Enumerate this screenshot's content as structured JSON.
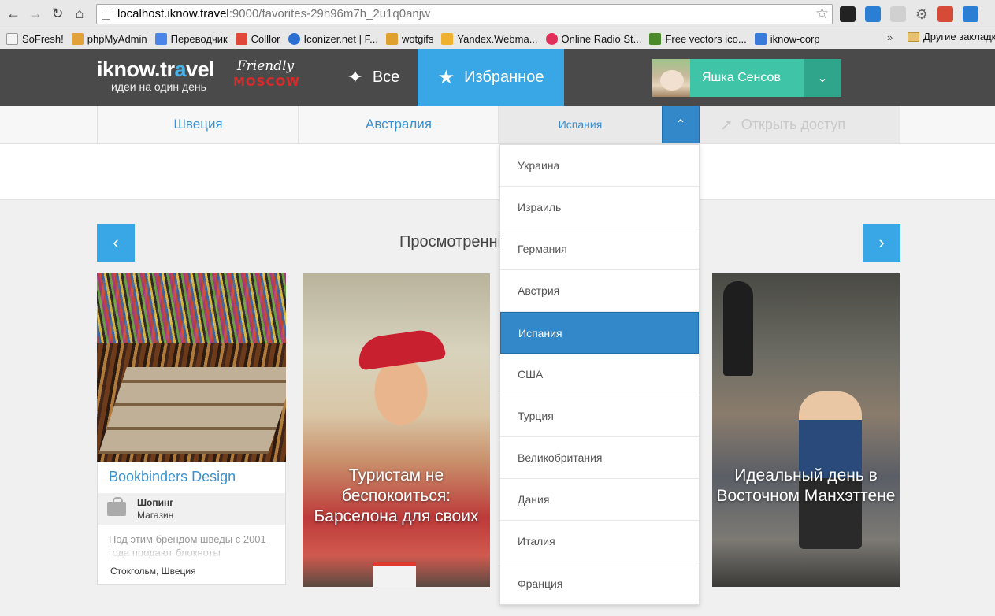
{
  "browser": {
    "url_host": "localhost.iknow.travel",
    "url_rest": ":9000/favorites-29h96m7h_2u1q0anjw",
    "bookmarks": [
      {
        "label": "SoFresh!",
        "color": "#f4f4f4"
      },
      {
        "label": "phpMyAdmin",
        "color": "#e2a23a"
      },
      {
        "label": "Переводчик",
        "color": "#4a86e8"
      },
      {
        "label": "Colllor",
        "color": "#e0493a"
      },
      {
        "label": "Iconizer.net | F...",
        "color": "#2a6fd1"
      },
      {
        "label": "wotgifs",
        "color": "#e0a030"
      },
      {
        "label": "Yandex.Webma...",
        "color": "#f0b030"
      },
      {
        "label": "Online Radio St...",
        "color": "#e0305a"
      },
      {
        "label": "Free vectors ico...",
        "color": "#4a8a2a"
      },
      {
        "label": "iknow-corp",
        "color": "#3a7ad8"
      }
    ],
    "bookmarks_more": "»",
    "other_bookmarks": "Другие закладки"
  },
  "header": {
    "logo_main": "iknow.tr",
    "logo_accent": "a",
    "logo_end": "vel",
    "tagline": "идеи на один день",
    "friendly_top": "Friendly",
    "friendly_bottom": "MOSCOW",
    "tab_all": "Все",
    "tab_favorites": "Избранное",
    "user_name": "Яшка Сенсов"
  },
  "countries": {
    "tabs": [
      "Швеция",
      "Австралия",
      "Испания"
    ],
    "share_label": "Открыть доступ",
    "dropdown": [
      "Украина",
      "Израиль",
      "Германия",
      "Австрия",
      "Испания",
      "США",
      "Турция",
      "Великобритания",
      "Дания",
      "Италия",
      "Франция"
    ],
    "selected": "Испания"
  },
  "viewed": {
    "title": "Просмотренные",
    "cards": [
      {
        "title": "Bookbinders Design",
        "category": "Шопинг",
        "subcategory": "Магазин",
        "description": "Под этим брендом шведы с 2001 года продают блокноты",
        "location": "Стокгольм, Швеция"
      },
      {
        "overlay": "Туристам не беспокоиться: Барселона для своих"
      },
      {
        "overlay": "Идеальный день в Восточном Манхэттене"
      }
    ]
  },
  "colors": {
    "accent_blue": "#39a7e6",
    "header_bg": "#4a4a4a",
    "user_green": "#3fc4a7",
    "dropdown_active": "#3288c9"
  }
}
